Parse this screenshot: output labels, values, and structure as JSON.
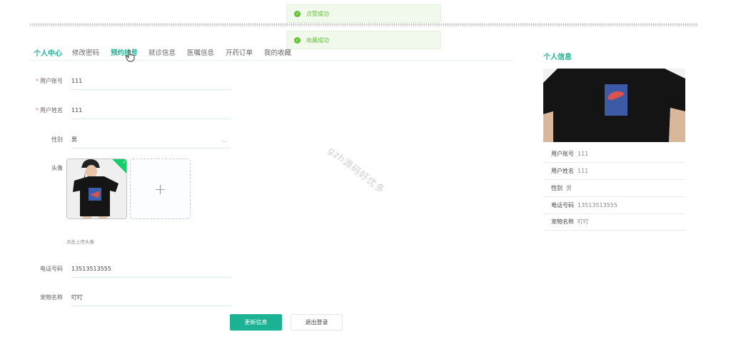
{
  "toasts": [
    "点赞成功",
    "收藏成功"
  ],
  "tabs": [
    "个人中心",
    "修改密码",
    "预约挂号",
    "就诊信息",
    "医嘱信息",
    "开药订单",
    "我的收藏"
  ],
  "form": {
    "account_label": "用户账号",
    "account_value": "111",
    "name_label": "用户姓名",
    "name_value": "111",
    "gender_label": "性别",
    "gender_value": "男",
    "avatar_label": "头像",
    "upload_hint": "点击上传头像",
    "phone_label": "电话号码",
    "phone_value": "13513513555",
    "pet_label": "宠物名称",
    "pet_value": "叮叮",
    "required_mark": "*",
    "plus": "+"
  },
  "buttons": {
    "update": "更新信息",
    "logout": "退出登录"
  },
  "watermark": "gzh源码好优多",
  "profile": {
    "title": "个人信息",
    "rows": [
      {
        "k": "用户账号",
        "v": "111"
      },
      {
        "k": "用户姓名",
        "v": "111"
      },
      {
        "k": "性别",
        "v": "男"
      },
      {
        "k": "电话号码",
        "v": "13513513555"
      },
      {
        "k": "宠物名称",
        "v": "叮叮"
      }
    ]
  },
  "colors": {
    "accent": "#1bb394",
    "success_toast_bg": "#f0f9eb",
    "success_text": "#67c23a"
  },
  "icons": [
    "check-circle-icon",
    "chevron-down-icon",
    "plus-icon",
    "check-icon",
    "hand-cursor-icon"
  ]
}
